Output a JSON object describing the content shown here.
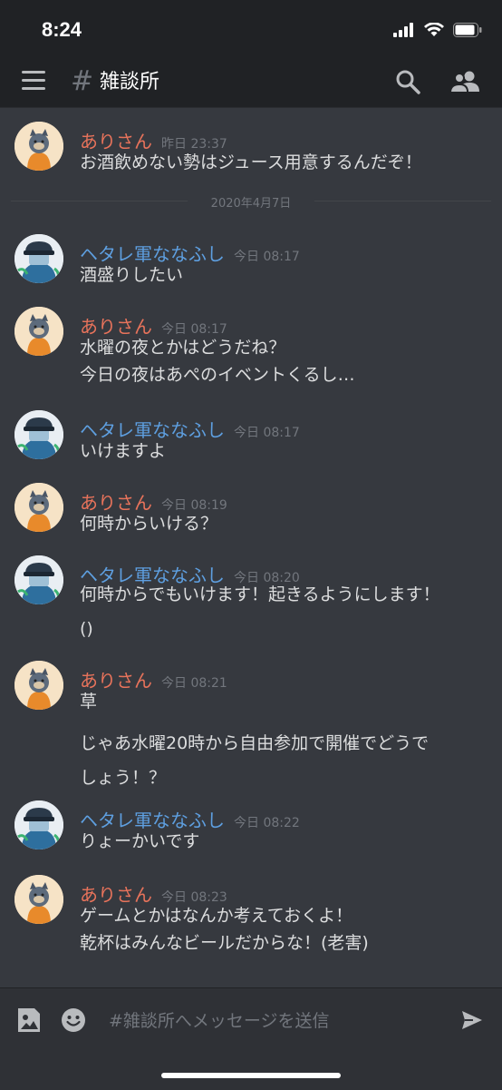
{
  "status_bar": {
    "time": "8:24"
  },
  "header": {
    "hash": "#",
    "channel_name": "雑談所"
  },
  "date_divider": "2020年4月7日",
  "messages": [
    {
      "author": "ありさん",
      "time": "昨日 23:37",
      "lines": [
        "お酒飲めない勢はジュース用意するんだぞ！"
      ]
    },
    {
      "author": "ヘタレ軍ななふし",
      "time": "今日 08:17",
      "lines": [
        "酒盛りしたい"
      ]
    },
    {
      "author": "ありさん",
      "time": "今日 08:17",
      "lines": [
        "水曜の夜とかはどうだね？",
        "今日の夜はあぺのイベントくるし…"
      ]
    },
    {
      "author": "ヘタレ軍ななふし",
      "time": "今日 08:17",
      "lines": [
        "いけますよ"
      ]
    },
    {
      "author": "ありさん",
      "time": "今日 08:19",
      "lines": [
        "何時からいける？"
      ]
    },
    {
      "author": "ヘタレ軍ななふし",
      "time": "今日 08:20",
      "lines": [
        "何時からでもいけます！起きるようにします！",
        "()"
      ]
    },
    {
      "author": "ありさん",
      "time": "今日 08:21",
      "lines": [
        "草",
        "じゃあ水曜20時から自由参加で開催でどうで",
        "しょう！？"
      ]
    },
    {
      "author": "ヘタレ軍ななふし",
      "time": "今日 08:22",
      "lines": [
        "りょーかいです"
      ]
    },
    {
      "author": "ありさん",
      "time": "今日 08:23",
      "lines": [
        "ゲームとかはなんか考えておくよ！",
        "乾杯はみんなビールだからな！(老害)"
      ]
    }
  ],
  "composer": {
    "placeholder": "#雑談所へメッセージを送信"
  },
  "colors": {
    "ari": "#e8735b",
    "heta": "#5e9fe0",
    "background": "#36393f"
  },
  "icons": [
    "hamburger-icon",
    "search-icon",
    "members-icon",
    "image-icon",
    "emoji-icon",
    "send-icon"
  ]
}
